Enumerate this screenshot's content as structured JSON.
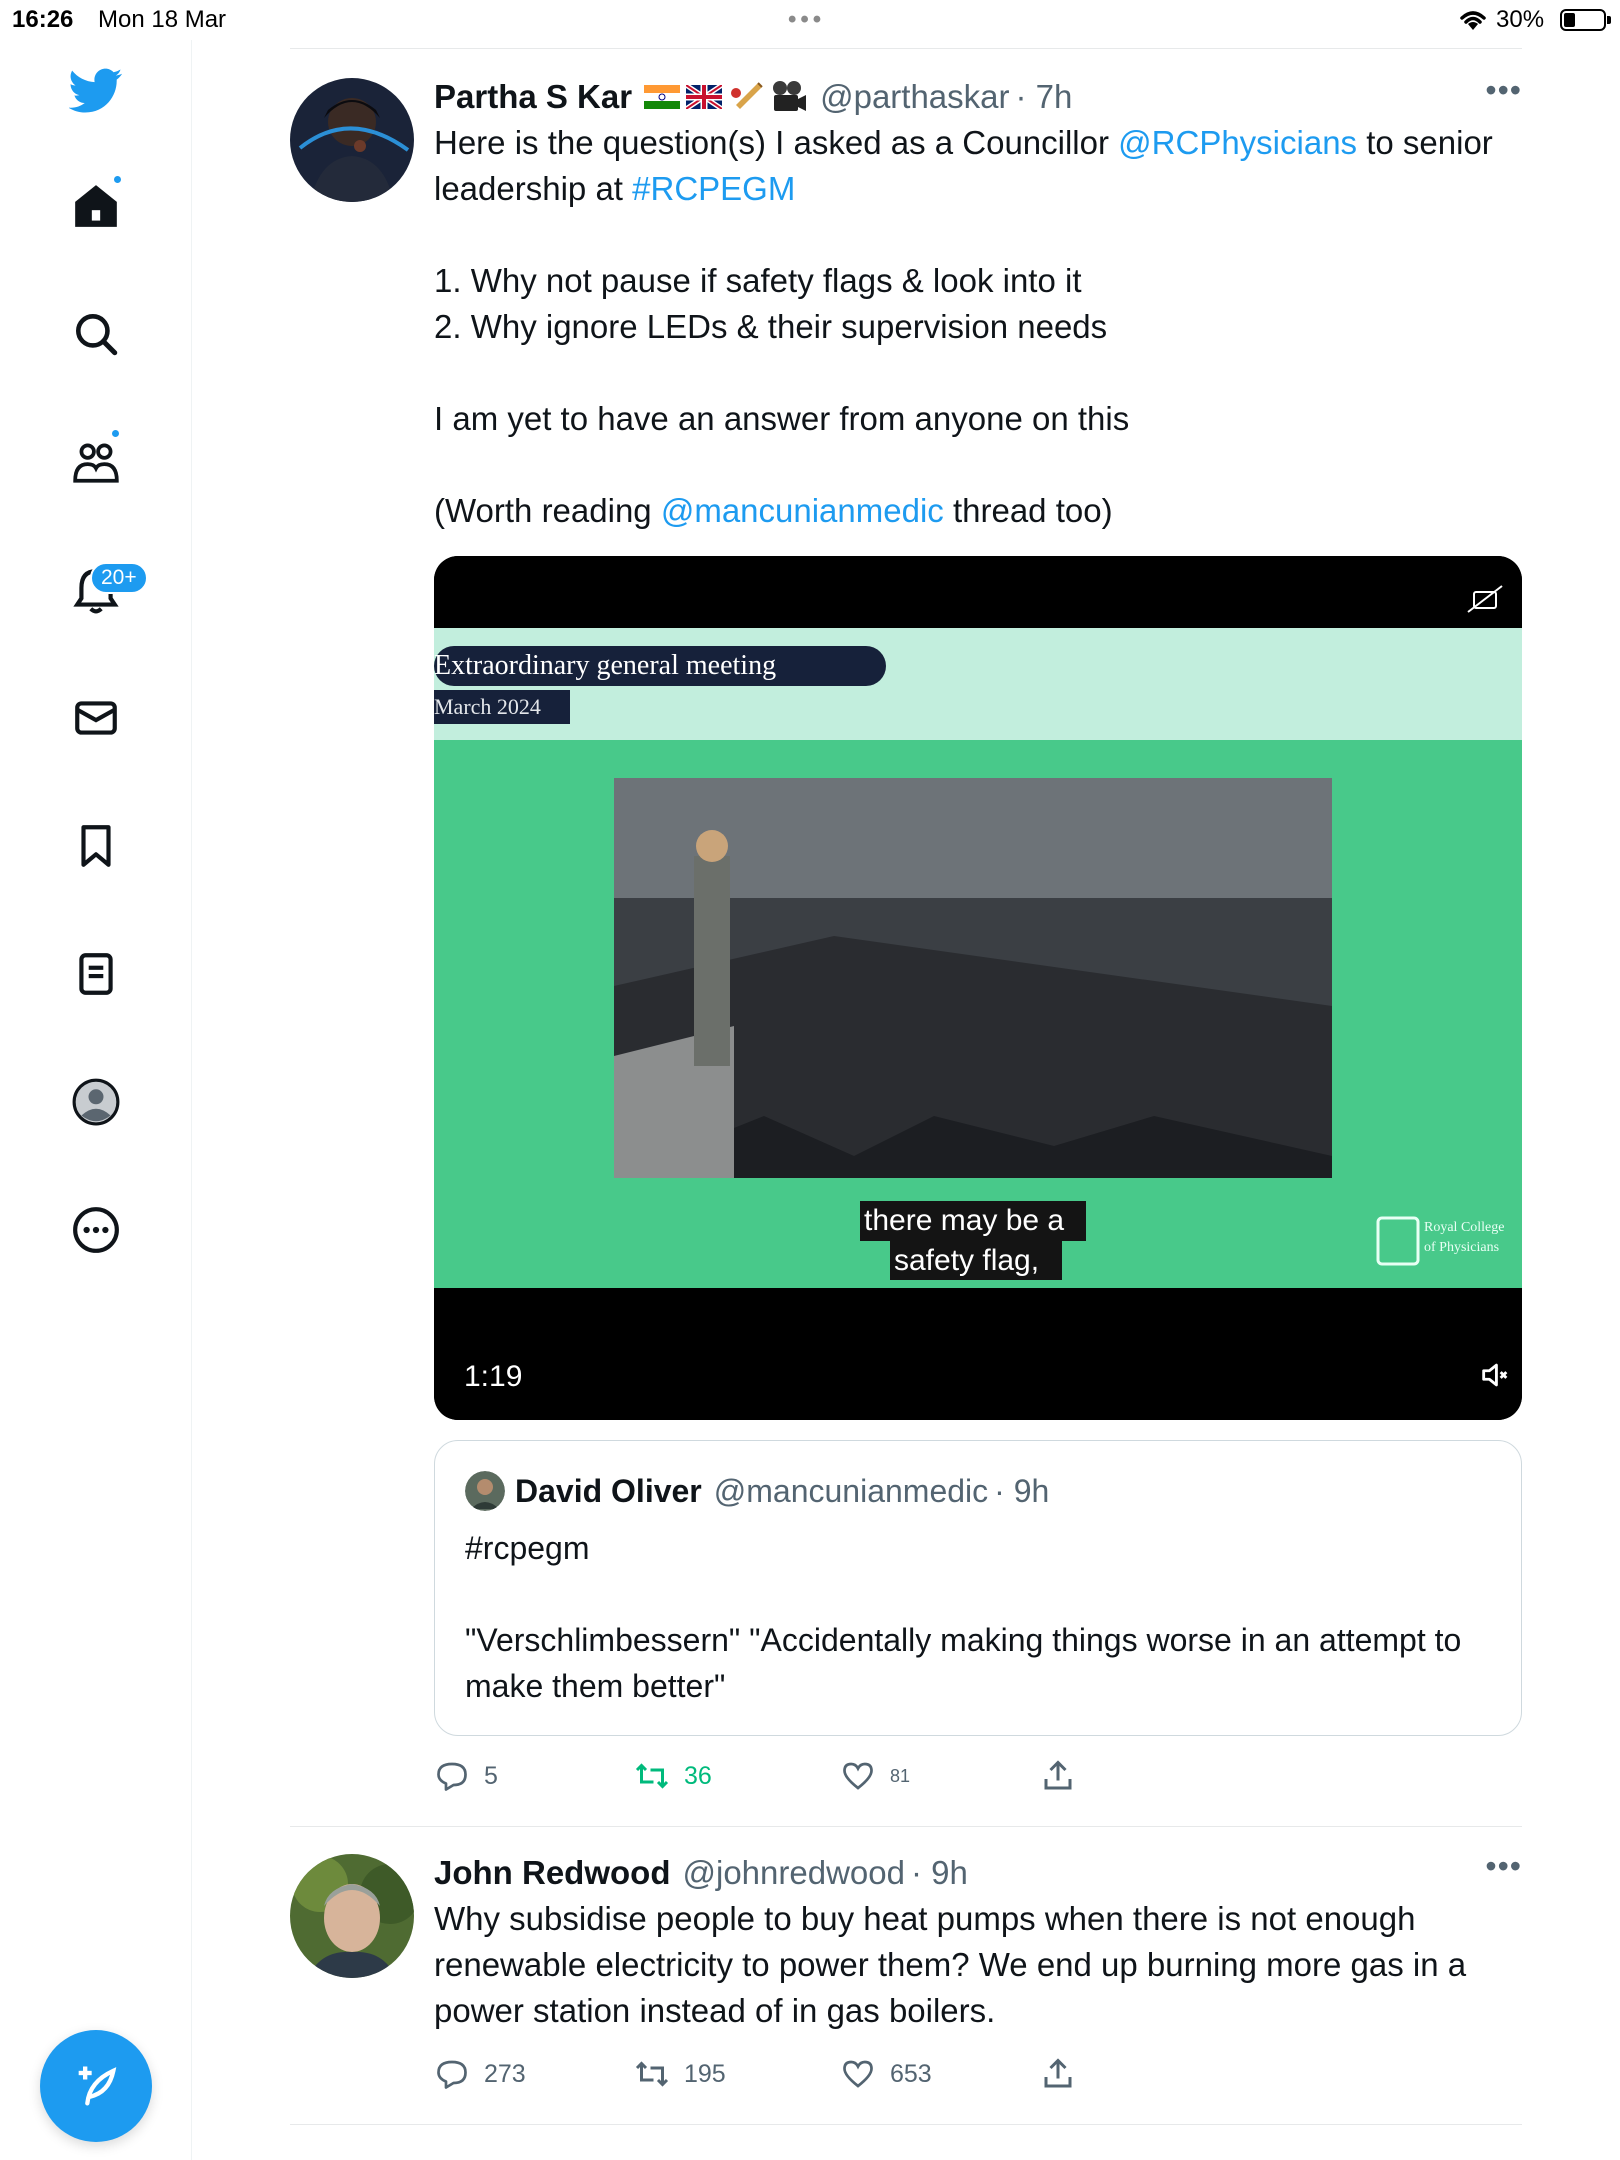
{
  "status_bar": {
    "time": "16:26",
    "date": "Mon 18 Mar",
    "battery": "30%",
    "battery_level": 0.3
  },
  "sidebar": {
    "items": [
      {
        "name": "home",
        "icon": "home-icon",
        "has_dot": true
      },
      {
        "name": "explore",
        "icon": "search-icon"
      },
      {
        "name": "communities",
        "icon": "communities-icon",
        "has_dot": true
      },
      {
        "name": "notifications",
        "icon": "bell-icon",
        "badge": "20+"
      },
      {
        "name": "messages",
        "icon": "envelope-icon"
      },
      {
        "name": "bookmarks",
        "icon": "bookmark-icon"
      },
      {
        "name": "lists",
        "icon": "list-icon"
      },
      {
        "name": "profile",
        "icon": "profile-icon"
      },
      {
        "name": "more",
        "icon": "more-circle-icon"
      }
    ]
  },
  "colors": {
    "accent": "#1d9bf0",
    "retweet_green": "#00ba7c",
    "video_green": "#48c98a",
    "video_mint": "#c2eedd"
  },
  "tweets": [
    {
      "name": "Partha S Kar",
      "handle": "@parthaskar",
      "time": "· 7h",
      "text": {
        "l1_pre": "Here is the question(s) I asked as a Councillor ",
        "l1_mention": "@RCPhysicians",
        "l1_post": " to senior leadership at ",
        "l1_tag": "#RCPEGM",
        "p2": "1. Why not pause if safety flags & look into it",
        "p3": "2. Why ignore LEDs & their supervision needs",
        "p4": "I am yet to have an answer from anyone on this",
        "p5_pre": "(Worth reading ",
        "p5_mention": "@mancunianmedic",
        "p5_post": " thread too)"
      },
      "video": {
        "banner_title": "Extraordinary general meeting",
        "banner_date": "March 2024",
        "caption_1": "there may be a",
        "caption_2": "safety flag,",
        "logo_1": "Royal College",
        "logo_2": "of Physicians",
        "duration": "1:19"
      },
      "quote": {
        "name": "David Oliver",
        "handle": "@mancunianmedic",
        "time": "· 9h",
        "p1": "#rcpegm",
        "p2": "\"Verschlimbessern\"  \"Accidentally making things worse in an attempt to make them better\""
      },
      "actions": {
        "replies": "5",
        "retweets": "36",
        "likes": "81"
      }
    },
    {
      "name": "John Redwood",
      "handle": "@johnredwood",
      "time": "· 9h",
      "text": "Why subsidise  people to buy heat  pumps when there is not enough renewable electricity to power them? We end up burning more gas in a power station instead of in gas boilers.",
      "actions": {
        "replies": "273",
        "retweets": "195",
        "likes": "653"
      }
    }
  ]
}
